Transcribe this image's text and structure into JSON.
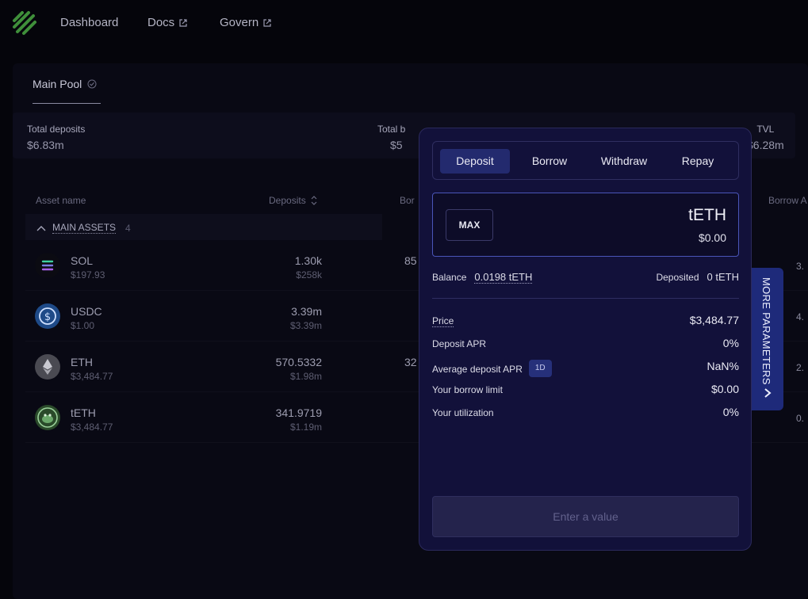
{
  "nav": {
    "dashboard": "Dashboard",
    "docs": "Docs",
    "govern": "Govern"
  },
  "pool": {
    "tab_label": "Main Pool"
  },
  "stats": {
    "total_deposits_label": "Total deposits",
    "total_deposits_value": "$6.83m",
    "total_borrows_label": "Total b",
    "total_borrows_value": "$5",
    "tvl_label": "TVL",
    "tvl_value": "$6.28m"
  },
  "table": {
    "col_asset": "Asset name",
    "col_deposits": "Deposits",
    "col_borrows": "Bor",
    "col_borrow_apr": "Borrow A",
    "group_label": "MAIN ASSETS",
    "group_count": "4",
    "rows": [
      {
        "name": "SOL",
        "price": "$197.93",
        "deposits": "1.30k",
        "deposits_usd": "$258k",
        "borrows": "85",
        "apr": "3."
      },
      {
        "name": "USDC",
        "price": "$1.00",
        "deposits": "3.39m",
        "deposits_usd": "$3.39m",
        "borrows": "",
        "apr": "4."
      },
      {
        "name": "ETH",
        "price": "$3,484.77",
        "deposits": "570.5332",
        "deposits_usd": "$1.98m",
        "borrows": "32",
        "apr": "2."
      },
      {
        "name": "tETH",
        "price": "$3,484.77",
        "deposits": "341.9719",
        "deposits_usd": "$1.19m",
        "borrows": "",
        "apr": "0."
      }
    ]
  },
  "modal": {
    "tabs": [
      "Deposit",
      "Borrow",
      "Withdraw",
      "Repay"
    ],
    "active_tab": "Deposit",
    "max_label": "MAX",
    "token_symbol": "tETH",
    "token_usd": "$0.00",
    "balance_label": "Balance",
    "balance_value": "0.0198 tETH",
    "deposited_label": "Deposited",
    "deposited_value": "0 tETH",
    "params": [
      {
        "label": "Price",
        "value": "$3,484.77"
      },
      {
        "label": "Deposit APR",
        "value": "0%"
      },
      {
        "label": "Average deposit APR",
        "value": "NaN%",
        "badge": "1D"
      },
      {
        "label": "Your borrow limit",
        "value": "$0.00"
      },
      {
        "label": "Your utilization",
        "value": "0%"
      }
    ],
    "submit_label": "Enter a value",
    "side_tab_label": "MORE PARAMETERS"
  },
  "colors": {
    "accent": "#232a6e",
    "modal_bg": "#12113a",
    "page_bg": "#05050b"
  }
}
